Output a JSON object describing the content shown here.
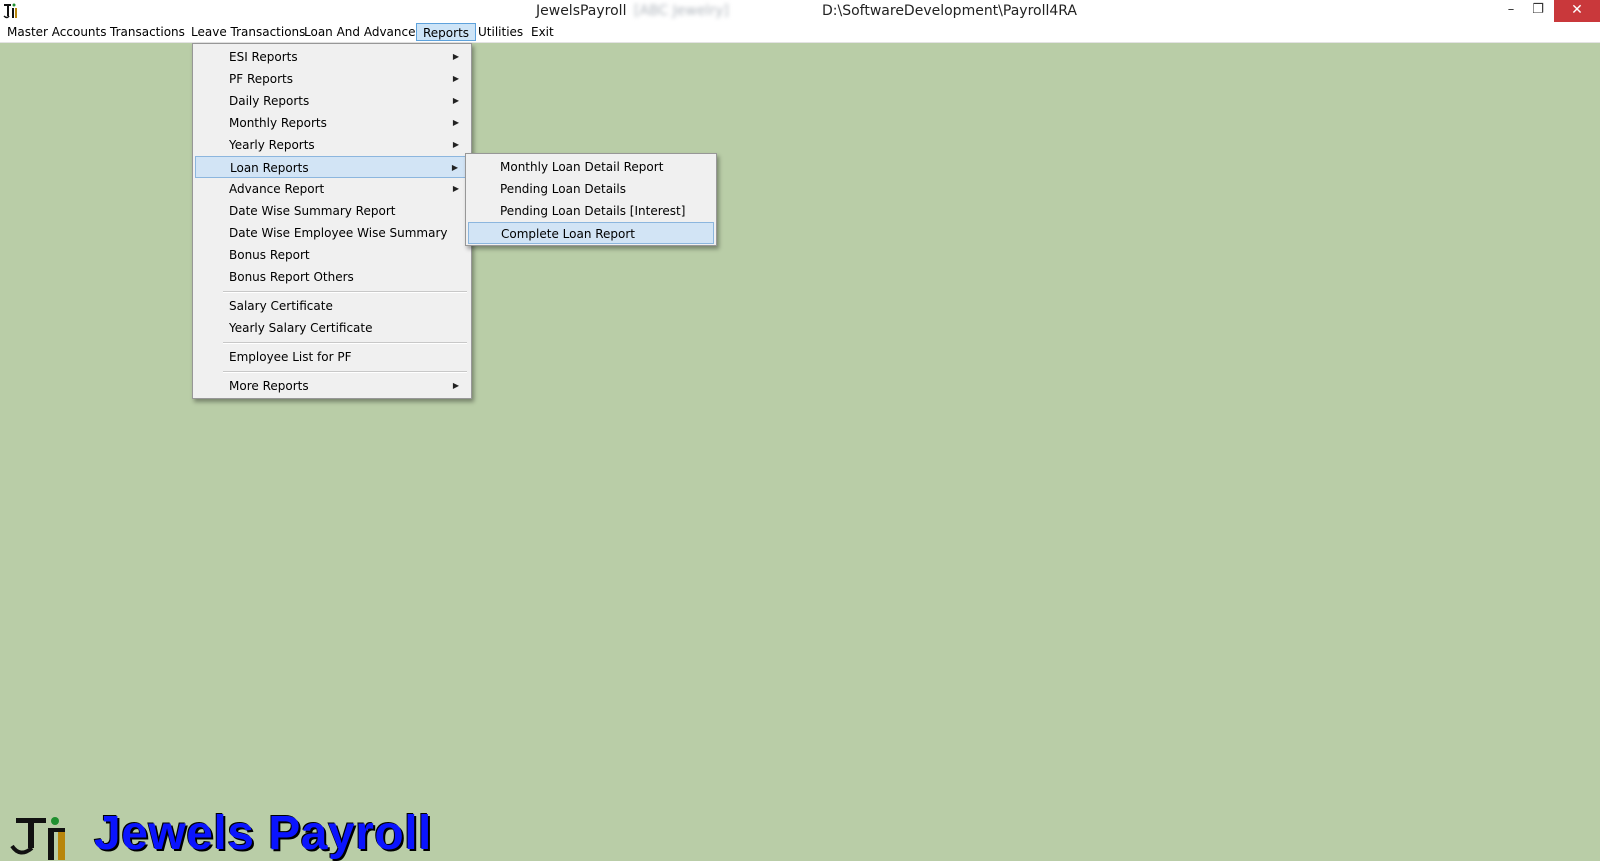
{
  "window": {
    "app_name": "JewelsPayroll",
    "company": "[ABC Jewelry]",
    "path": "D:\\SoftwareDevelopment\\Payroll4RA",
    "min_glyph": "–",
    "max_glyph": "❐",
    "close_glyph": "✕"
  },
  "menubar": {
    "items": [
      {
        "label": "Master Accounts"
      },
      {
        "label": "Transactions"
      },
      {
        "label": "Leave Transactions"
      },
      {
        "label": "Loan And Advances"
      },
      {
        "label": "Reports"
      },
      {
        "label": "Utilities"
      },
      {
        "label": "Exit"
      }
    ],
    "active": "Reports"
  },
  "reports_menu": {
    "items": [
      {
        "label": "ESI Reports",
        "submenu": true
      },
      {
        "label": "PF Reports",
        "submenu": true
      },
      {
        "label": "Daily Reports",
        "submenu": true
      },
      {
        "label": "Monthly Reports",
        "submenu": true
      },
      {
        "label": "Yearly Reports",
        "submenu": true
      },
      {
        "label": "Loan Reports",
        "submenu": true,
        "highlighted": true
      },
      {
        "label": "Advance Report",
        "submenu": true
      },
      {
        "label": "Date Wise Summary Report"
      },
      {
        "label": "Date Wise Employee Wise Summary"
      },
      {
        "label": "Bonus Report"
      },
      {
        "label": "Bonus Report Others"
      },
      {
        "label": "Salary Certificate"
      },
      {
        "label": "Yearly Salary Certificate"
      },
      {
        "label": "Employee List for PF"
      },
      {
        "label": "More Reports",
        "submenu": true
      }
    ],
    "arrow_glyph": "▶"
  },
  "loan_reports_menu": {
    "items": [
      {
        "label": "Monthly Loan Detail Report"
      },
      {
        "label": "Pending Loan Details"
      },
      {
        "label": "Pending Loan Details [Interest]"
      },
      {
        "label": "Complete Loan Report",
        "highlighted": true
      }
    ]
  },
  "brand": {
    "text": "Jewels Payroll"
  },
  "colors": {
    "background": "#b9cda7",
    "highlight": "#d2e4f5",
    "close_button": "#c9383b",
    "brand_text": "#0a14ff"
  }
}
